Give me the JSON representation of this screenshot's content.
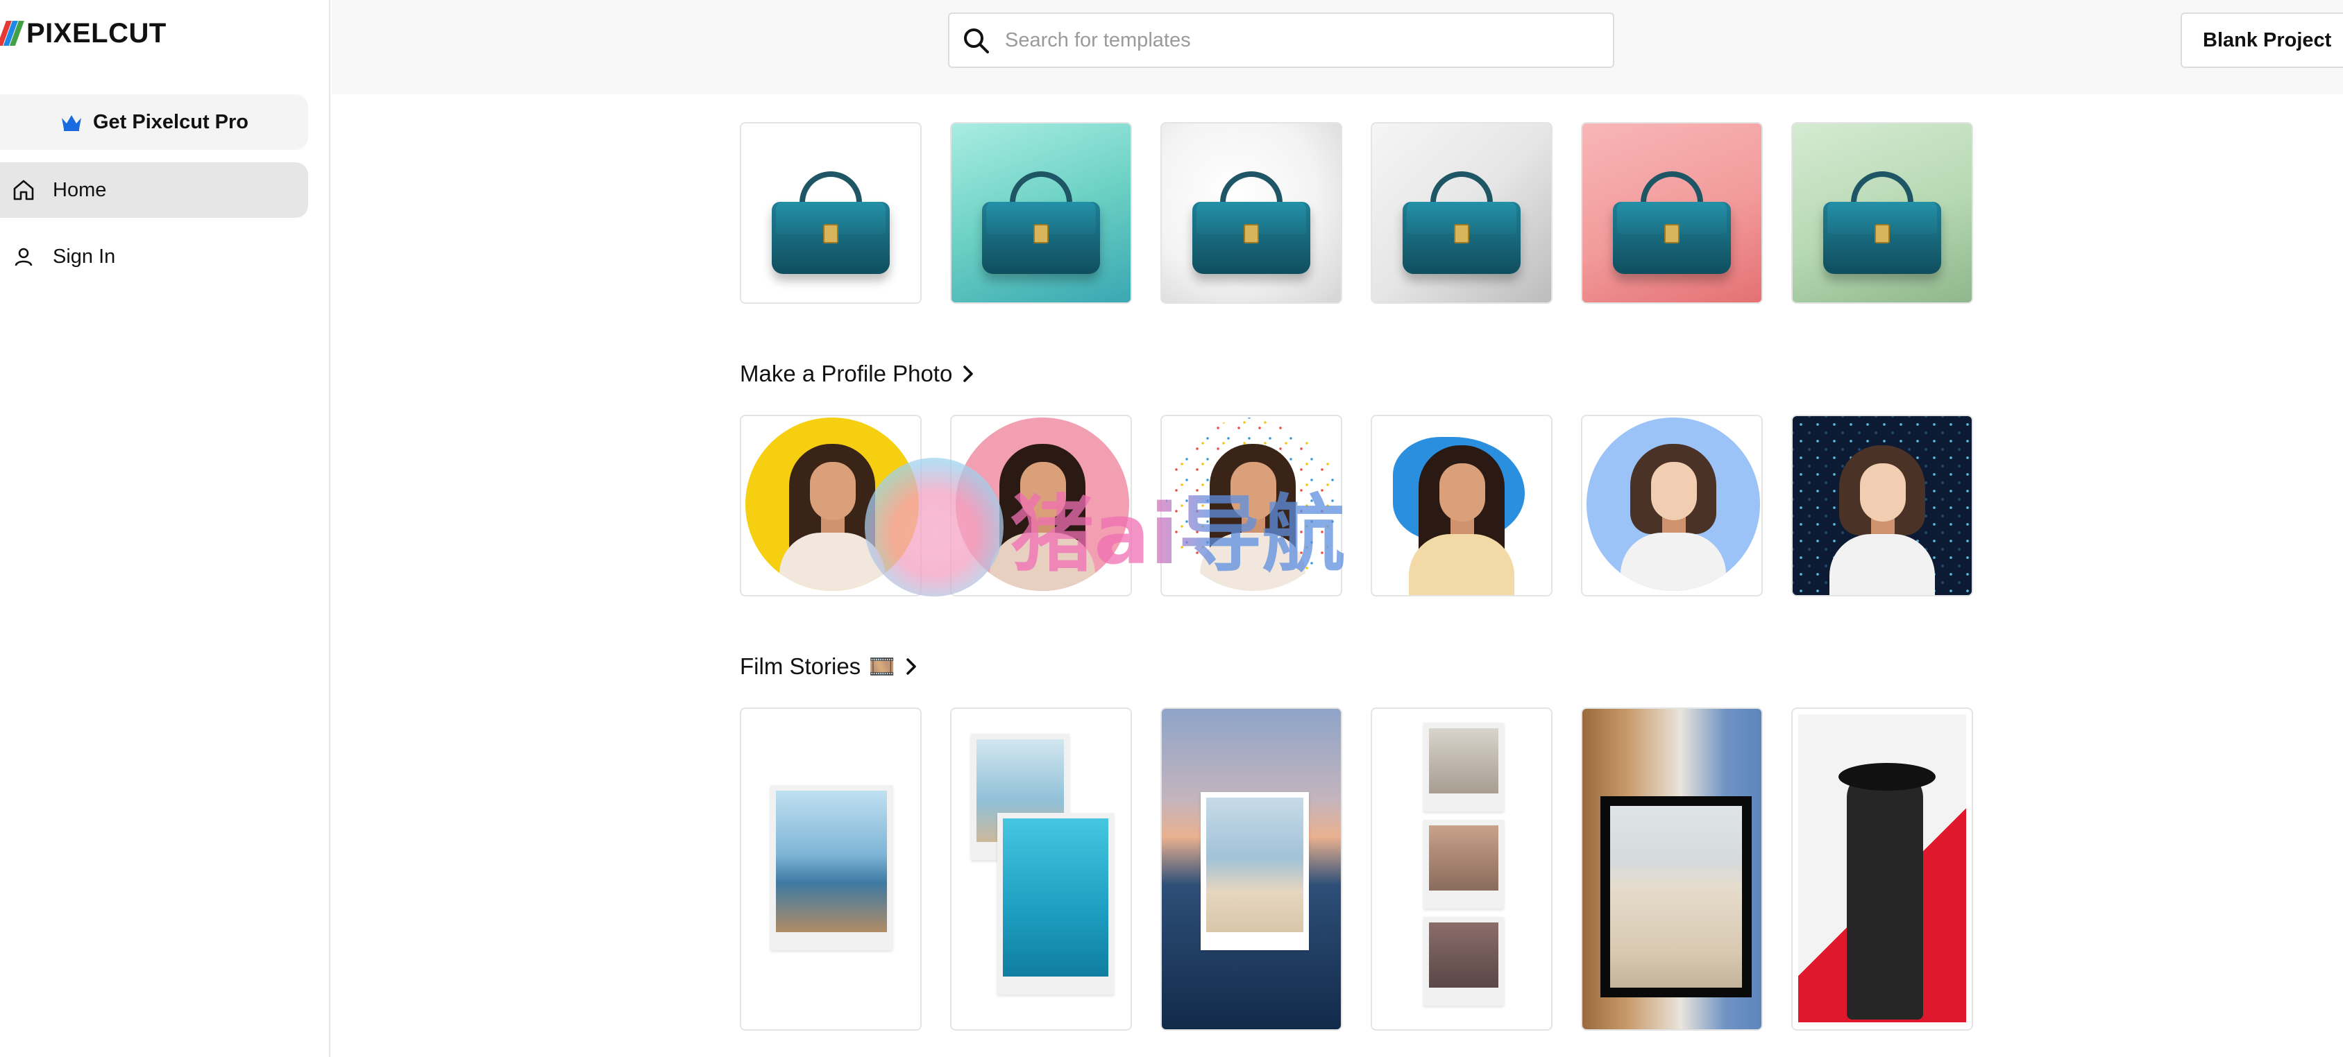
{
  "app": {
    "logo_text": "PIXELCUT"
  },
  "sidebar": {
    "pro_label": "Get Pixelcut Pro",
    "items": [
      {
        "label": "Home",
        "icon": "home-icon",
        "active": true
      },
      {
        "label": "Sign In",
        "icon": "user-icon",
        "active": false
      }
    ]
  },
  "header": {
    "search_placeholder": "Search for templates",
    "blank_project_label": "Blank Project"
  },
  "sections": {
    "bags": {
      "backgrounds": [
        "#ffffff",
        "teal-gradient",
        "white-gradient",
        "grey-gradient",
        "pink-gradient",
        "green-gradient"
      ]
    },
    "profile": {
      "title": "Make a Profile Photo"
    },
    "film": {
      "title": "Film Stories",
      "emoji": "🎞️"
    }
  },
  "watermark": {
    "text": "猪ai导航"
  },
  "colors": {
    "accent": "#1a73e8",
    "crown": "#1a6be0"
  }
}
